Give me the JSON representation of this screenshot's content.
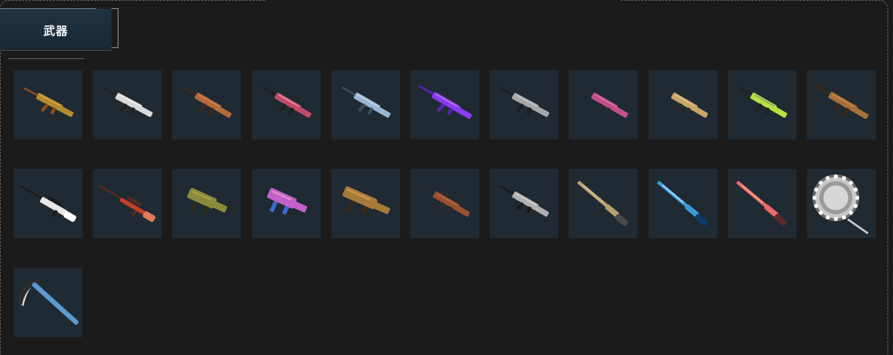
{
  "panel": {
    "title": "武器"
  },
  "items": [
    {
      "name": "weapon-rifle-gold",
      "icon": "rifle-icon",
      "colors": [
        "#b38b2e",
        "#8a4a20",
        "#d8a84a"
      ],
      "kind": "rifle-bullpup"
    },
    {
      "name": "weapon-rifle-white",
      "icon": "rifle-icon",
      "colors": [
        "#d9d9d9",
        "#222222",
        "#f0f0f0"
      ],
      "kind": "rifle-bullpup"
    },
    {
      "name": "weapon-rifle-copper",
      "icon": "rifle-icon",
      "colors": [
        "#b56a3a",
        "#3a2a22",
        "#d48a55"
      ],
      "kind": "rifle"
    },
    {
      "name": "weapon-rifle-candy",
      "icon": "rifle-icon",
      "colors": [
        "#c44a6a",
        "#202020",
        "#e8b0b8"
      ],
      "kind": "rifle"
    },
    {
      "name": "weapon-rifle-frost",
      "icon": "rifle-icon",
      "colors": [
        "#9ab6d4",
        "#3c4a58",
        "#d6e4f2"
      ],
      "kind": "rifle"
    },
    {
      "name": "weapon-rifle-violet",
      "icon": "rifle-icon",
      "colors": [
        "#8a3cf0",
        "#5a22b0",
        "#c88ad8"
      ],
      "kind": "rifle-long"
    },
    {
      "name": "weapon-rifle-silver",
      "icon": "rifle-icon",
      "colors": [
        "#a8a8a8",
        "#1e1e1e",
        "#d0d0d0"
      ],
      "kind": "rifle-bullpup"
    },
    {
      "name": "weapon-rifle-rose",
      "icon": "rifle-icon",
      "colors": [
        "#c2508a",
        "#2a2a2a",
        "#e07aa8"
      ],
      "kind": "rifle"
    },
    {
      "name": "weapon-rifle-sand",
      "icon": "rifle-icon",
      "colors": [
        "#c8a46a",
        "#2a2a2a",
        "#e8cc92"
      ],
      "kind": "rifle"
    },
    {
      "name": "weapon-rifle-lime",
      "icon": "rifle-icon",
      "colors": [
        "#b8e040",
        "#222222",
        "#8a8a8a"
      ],
      "kind": "rifle"
    },
    {
      "name": "weapon-rifle-bronze",
      "icon": "rifle-icon",
      "colors": [
        "#a8703a",
        "#3a2a1a",
        "#d09058"
      ],
      "kind": "rifle-long"
    },
    {
      "name": "weapon-sniper-white",
      "icon": "sniper-icon",
      "colors": [
        "#e8e8e8",
        "#1a1a1a",
        "#ffffff"
      ],
      "kind": "sniper"
    },
    {
      "name": "weapon-sniper-red",
      "icon": "sniper-icon",
      "colors": [
        "#c0402a",
        "#5a2a20",
        "#e27a5a"
      ],
      "kind": "sniper-thin"
    },
    {
      "name": "weapon-smg-olive",
      "icon": "smg-icon",
      "colors": [
        "#8a8a3a",
        "#2a2a1a",
        "#b0a85a"
      ],
      "kind": "smg"
    },
    {
      "name": "weapon-smg-holo",
      "icon": "smg-icon",
      "colors": [
        "#c060c8",
        "#3a6ad0",
        "#e8a0c0"
      ],
      "kind": "smg"
    },
    {
      "name": "weapon-smg-scoped",
      "icon": "smg-icon",
      "colors": [
        "#a87a3a",
        "#3a2a1a",
        "#d0a050"
      ],
      "kind": "smg-wide"
    },
    {
      "name": "weapon-lmg-rust",
      "icon": "lmg-icon",
      "colors": [
        "#9a5030",
        "#2a2a2a",
        "#c07040"
      ],
      "kind": "lmg"
    },
    {
      "name": "weapon-rifle-steel",
      "icon": "rifle-icon",
      "colors": [
        "#b0b0b0",
        "#1a1a1a",
        "#e0e0e0"
      ],
      "kind": "rifle"
    },
    {
      "name": "weapon-shotgun-tan",
      "icon": "shotgun-icon",
      "colors": [
        "#b8a070",
        "#4a4a4a",
        "#d8c090"
      ],
      "kind": "shotgun"
    },
    {
      "name": "weapon-shotgun-ice",
      "icon": "shotgun-icon",
      "colors": [
        "#3a9ad8",
        "#0c3a6a",
        "#bfe8ff"
      ],
      "kind": "shotgun"
    },
    {
      "name": "weapon-shotgun-coral",
      "icon": "shotgun-icon",
      "colors": [
        "#e86a6a",
        "#5a2a2a",
        "#f0b080"
      ],
      "kind": "shotgun"
    },
    {
      "name": "weapon-melee-chain",
      "icon": "chain-mace-icon",
      "colors": [
        "#c8c8c8",
        "#6a6a6a",
        "#ffffff"
      ],
      "kind": "mace"
    },
    {
      "name": "weapon-melee-scythe",
      "icon": "scythe-icon",
      "colors": [
        "#5a9ad0",
        "#2a2a2a",
        "#d8d8d8"
      ],
      "kind": "scythe"
    }
  ]
}
